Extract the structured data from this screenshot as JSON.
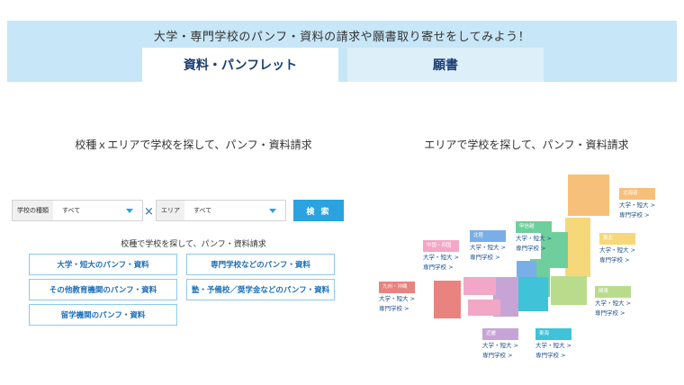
{
  "banner": {
    "title": "大学・専門学校のパンフ・資料の請求や願書取り寄せをしてみよう！",
    "tabs": [
      {
        "label": "資料・パンフレット",
        "active": true
      },
      {
        "label": "願書",
        "active": false
      }
    ]
  },
  "left": {
    "heading": "校種ｘエリアで学校を探して、パンフ・資料請求",
    "kind_select": {
      "label": "学校の種類",
      "value": "すべて"
    },
    "area_select": {
      "label": "エリア",
      "value": "すべて"
    },
    "cross": "×",
    "search_label": "検 索",
    "sub_heading": "校種で学校を探して、パンフ・資料請求",
    "categories": [
      {
        "label": "大学・短大のパンフ・資料"
      },
      {
        "label": "専門学校などのパンフ・資料"
      },
      {
        "label": "その他教育機関のパンフ・資料"
      },
      {
        "label": "塾・予備校／奨学金などのパンフ・資料"
      },
      {
        "label": "留学機関のパンフ・資料"
      }
    ]
  },
  "right": {
    "heading": "エリアで学校を探して、パンフ・資料請求",
    "regions": [
      {
        "name": "北海道",
        "color": "#f7c07a",
        "links": [
          "大学・短大 >",
          "専門学校 >"
        ]
      },
      {
        "name": "東北",
        "color": "#f6d87a",
        "links": [
          "大学・短大 >",
          "専門学校 >"
        ]
      },
      {
        "name": "関東",
        "color": "#b9dc8c",
        "links": [
          "大学・短大 >",
          "専門学校 >"
        ]
      },
      {
        "name": "甲信越",
        "color": "#6fcf9c",
        "links": [
          "大学・短大 >",
          "専門学校 >"
        ]
      },
      {
        "name": "北陸",
        "color": "#7aaee6",
        "links": [
          "大学・短大 >",
          "専門学校 >"
        ]
      },
      {
        "name": "東海",
        "color": "#3ec3d8",
        "links": [
          "大学・短大 >",
          "専門学校 >"
        ]
      },
      {
        "name": "近畿",
        "color": "#c7a4d6",
        "links": [
          "大学・短大 >",
          "専門学校 >"
        ]
      },
      {
        "name": "中国・四国",
        "color": "#f2a7c6",
        "links": [
          "大学・短大 >",
          "専門学校 >"
        ]
      },
      {
        "name": "九州・沖縄",
        "color": "#e8837f",
        "links": [
          "大学・短大 >",
          "専門学校 >"
        ]
      }
    ]
  }
}
